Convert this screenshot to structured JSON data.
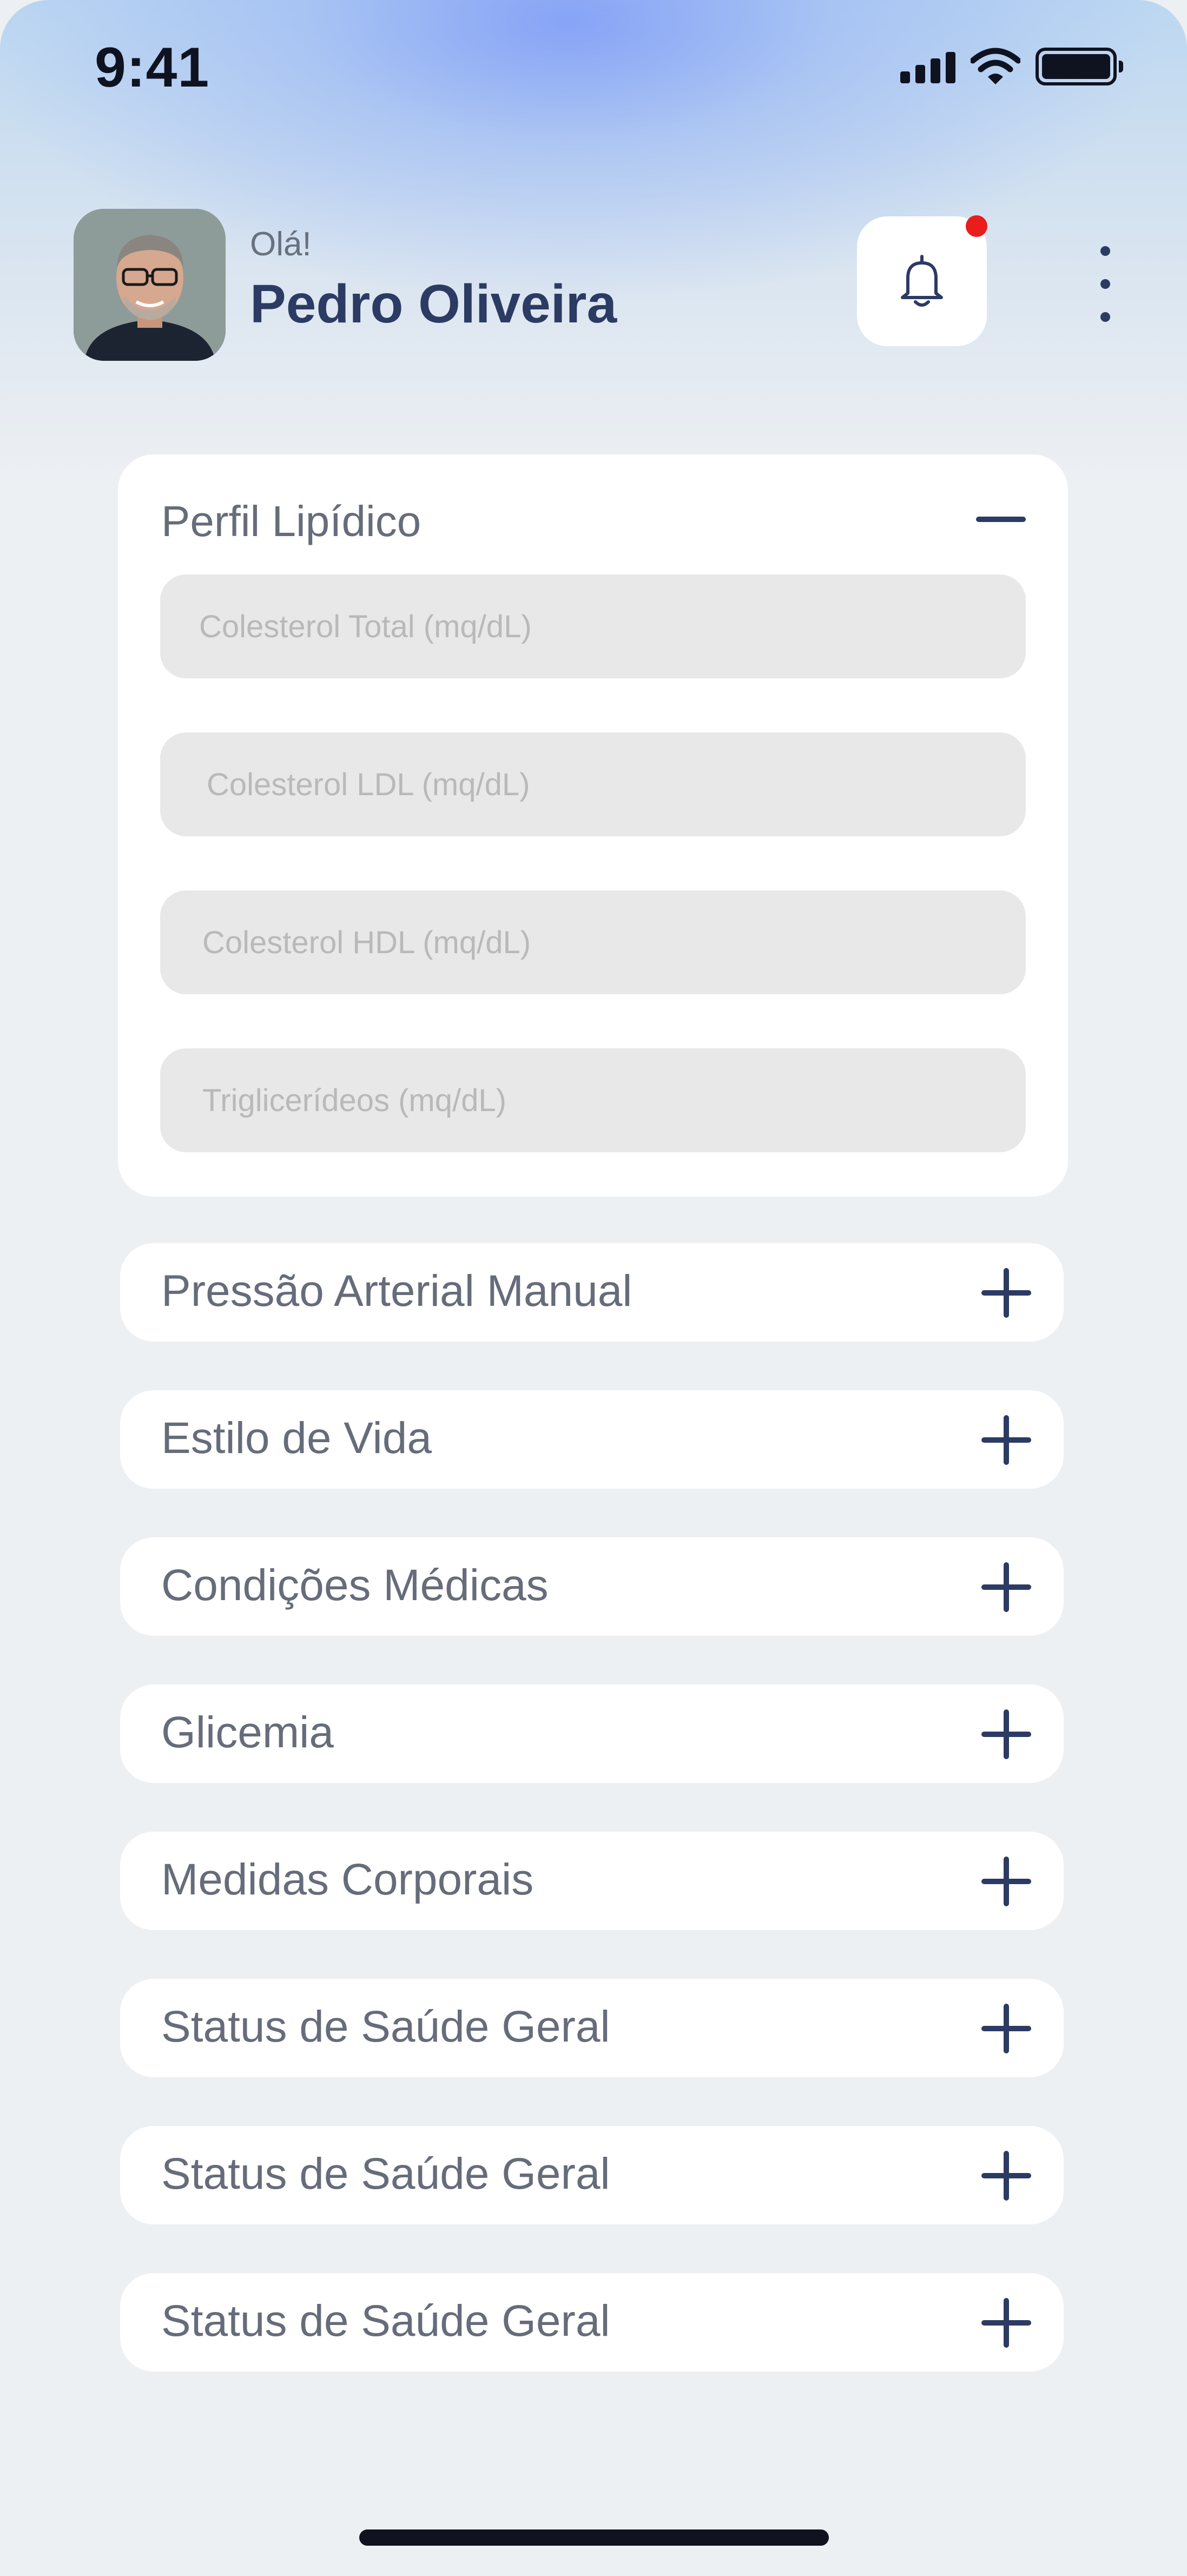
{
  "status_bar": {
    "time": "9:41"
  },
  "header": {
    "greeting": "Olá!",
    "user_name": "Pedro Oliveira",
    "has_notification": true
  },
  "lipid_profile": {
    "title": "Perfil Lipídico",
    "expanded": true,
    "fields": [
      {
        "placeholder": "Colesterol Total (mq/dL)",
        "value": ""
      },
      {
        "placeholder": "Colesterol LDL (mq/dL)",
        "value": ""
      },
      {
        "placeholder": "Colesterol HDL (mq/dL)",
        "value": ""
      },
      {
        "placeholder": "Triglicerídeos (mq/dL)",
        "value": ""
      }
    ]
  },
  "sections": [
    {
      "label": "Pressão Arterial Manual"
    },
    {
      "label": "Estilo de Vida"
    },
    {
      "label": "Condições Médicas"
    },
    {
      "label": "Glicemia"
    },
    {
      "label": "Medidas Corporais"
    },
    {
      "label": "Status de Saúde Geral"
    },
    {
      "label": "Status de Saúde Geral"
    },
    {
      "label": "Status de Saúde Geral"
    }
  ],
  "colors": {
    "primary": "#2c3b63",
    "notification": "#ea1c1c",
    "field_bg": "#e8e8e8",
    "page_bg": "#edf0f3"
  }
}
